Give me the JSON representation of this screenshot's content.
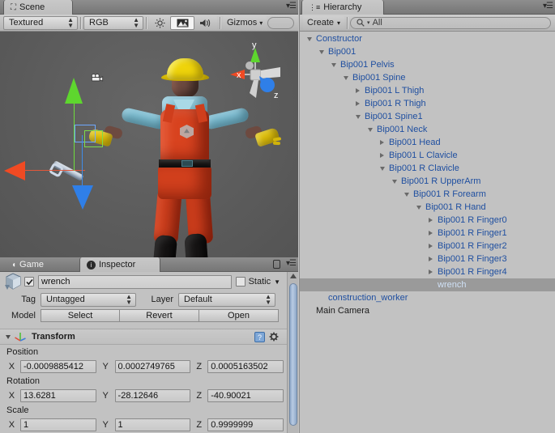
{
  "scene": {
    "tab_label": "Scene",
    "toolbar": {
      "draw_mode": "Textured",
      "render_mode": "RGB",
      "lighting_icon": "sun-icon",
      "fx_icon": "image-icon",
      "audio_icon": "speaker-icon",
      "gizmos_label": "Gizmos",
      "search_placeholder": ""
    },
    "gizmo": {
      "x": "x",
      "y": "y",
      "z": "z"
    },
    "selected_object": "wrench"
  },
  "game": {
    "tab_label": "Game"
  },
  "inspector": {
    "tab_label": "Inspector",
    "name": "wrench",
    "enabled": true,
    "static_label": "Static",
    "static_checked": false,
    "tag_label": "Tag",
    "tag_value": "Untagged",
    "layer_label": "Layer",
    "layer_value": "Default",
    "model_label": "Model",
    "model_buttons": [
      "Select",
      "Revert",
      "Open"
    ],
    "transform": {
      "title": "Transform",
      "position_label": "Position",
      "rotation_label": "Rotation",
      "scale_label": "Scale",
      "axes": [
        "X",
        "Y",
        "Z"
      ],
      "position": [
        "-0.0009885412",
        "0.0002749765",
        "0.0005163502"
      ],
      "rotation": [
        "13.6281",
        "-28.12646",
        "-40.90021"
      ],
      "scale": [
        "1",
        "1",
        "0.9999999"
      ]
    }
  },
  "hierarchy": {
    "tab_label": "Hierarchy",
    "create_label": "Create",
    "search_value": "All",
    "items": [
      {
        "label": "Constructor",
        "depth": 0,
        "state": "open",
        "selected": false,
        "plain": false
      },
      {
        "label": "Bip001",
        "depth": 1,
        "state": "open",
        "selected": false,
        "plain": false
      },
      {
        "label": "Bip001 Pelvis",
        "depth": 2,
        "state": "open",
        "selected": false,
        "plain": false
      },
      {
        "label": "Bip001 Spine",
        "depth": 3,
        "state": "open",
        "selected": false,
        "plain": false
      },
      {
        "label": "Bip001 L Thigh",
        "depth": 4,
        "state": "closed",
        "selected": false,
        "plain": false
      },
      {
        "label": "Bip001 R Thigh",
        "depth": 4,
        "state": "closed",
        "selected": false,
        "plain": false
      },
      {
        "label": "Bip001 Spine1",
        "depth": 4,
        "state": "open",
        "selected": false,
        "plain": false
      },
      {
        "label": "Bip001 Neck",
        "depth": 5,
        "state": "open",
        "selected": false,
        "plain": false
      },
      {
        "label": "Bip001 Head",
        "depth": 6,
        "state": "closed",
        "selected": false,
        "plain": false
      },
      {
        "label": "Bip001 L Clavicle",
        "depth": 6,
        "state": "closed",
        "selected": false,
        "plain": false
      },
      {
        "label": "Bip001 R Clavicle",
        "depth": 6,
        "state": "open",
        "selected": false,
        "plain": false
      },
      {
        "label": "Bip001 R UpperArm",
        "depth": 7,
        "state": "open",
        "selected": false,
        "plain": false
      },
      {
        "label": "Bip001 R Forearm",
        "depth": 8,
        "state": "open",
        "selected": false,
        "plain": false
      },
      {
        "label": "Bip001 R Hand",
        "depth": 9,
        "state": "open",
        "selected": false,
        "plain": false
      },
      {
        "label": "Bip001 R Finger0",
        "depth": 10,
        "state": "closed",
        "selected": false,
        "plain": false
      },
      {
        "label": "Bip001 R Finger1",
        "depth": 10,
        "state": "closed",
        "selected": false,
        "plain": false
      },
      {
        "label": "Bip001 R Finger2",
        "depth": 10,
        "state": "closed",
        "selected": false,
        "plain": false
      },
      {
        "label": "Bip001 R Finger3",
        "depth": 10,
        "state": "closed",
        "selected": false,
        "plain": false
      },
      {
        "label": "Bip001 R Finger4",
        "depth": 10,
        "state": "closed",
        "selected": false,
        "plain": false
      },
      {
        "label": "wrench",
        "depth": 10,
        "state": "leaf",
        "selected": true,
        "plain": false
      },
      {
        "label": "construction_worker",
        "depth": 1,
        "state": "leaf",
        "selected": false,
        "plain": false
      },
      {
        "label": "Main Camera",
        "depth": 0,
        "state": "leaf",
        "selected": false,
        "plain": true
      }
    ]
  },
  "colors": {
    "axis_x": "#f04a23",
    "axis_y": "#5ed62e",
    "axis_z": "#2f7fe8",
    "selection": "#9a9a9a",
    "prefab_text": "#1f4fa0",
    "panel_bg": "#c2c2c2",
    "scene_bg": "#5d5d5d"
  }
}
